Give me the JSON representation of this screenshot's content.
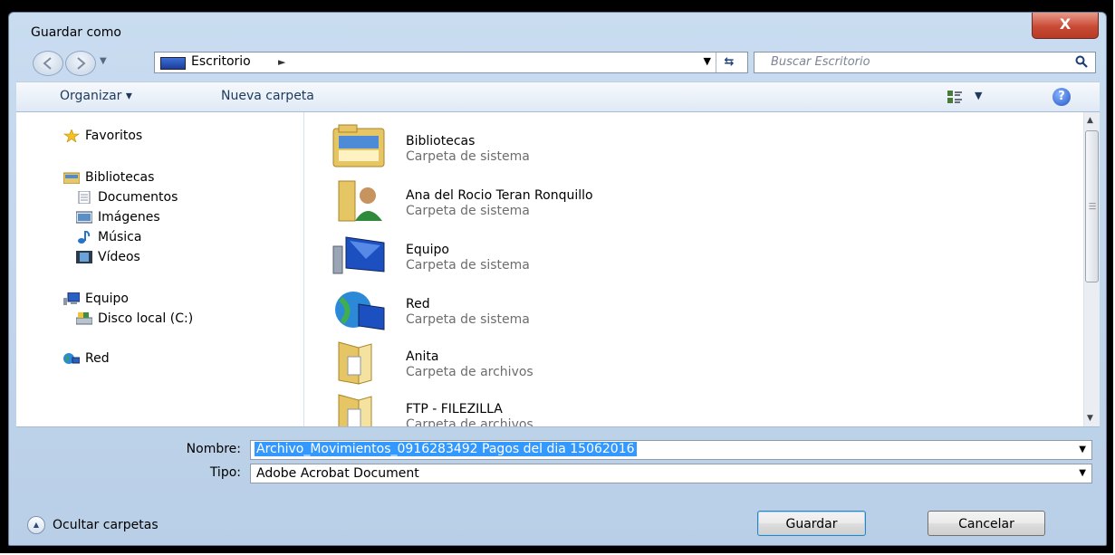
{
  "window": {
    "title": "Guardar como",
    "close_label": "X"
  },
  "navbar": {
    "address_label": "Escritorio",
    "search_placeholder": "Buscar Escritorio"
  },
  "toolbar": {
    "organize_label": "Organizar ▾",
    "new_folder_label": "Nueva carpeta"
  },
  "sidebar": {
    "favorites": "Favoritos",
    "libraries": "Bibliotecas",
    "documents": "Documentos",
    "images": "Imágenes",
    "music": "Música",
    "videos": "Vídeos",
    "computer": "Equipo",
    "local_disk": "Disco local (C:)",
    "network": "Red"
  },
  "files": [
    {
      "name": "Bibliotecas",
      "type": "Carpeta de sistema",
      "icon": "libraries-folder-icon"
    },
    {
      "name": "Ana del Rocio Teran Ronquillo",
      "type": "Carpeta de sistema",
      "icon": "user-folder-icon"
    },
    {
      "name": "Equipo",
      "type": "Carpeta de sistema",
      "icon": "computer-icon"
    },
    {
      "name": "Red",
      "type": "Carpeta de sistema",
      "icon": "network-icon"
    },
    {
      "name": "Anita",
      "type": "Carpeta de archivos",
      "icon": "folder-icon"
    },
    {
      "name": "FTP - FILEZILLA",
      "type": "Carpeta de archivos",
      "icon": "folder-icon"
    }
  ],
  "form": {
    "name_label": "Nombre:",
    "name_value": "Archivo_Movimientos_0916283492 Pagos del dia 15062016",
    "type_label": "Tipo:",
    "type_value": "Adobe Acrobat Document"
  },
  "footer": {
    "hide_folders_label": "Ocultar carpetas",
    "save_label": "Guardar",
    "cancel_label": "Cancelar"
  },
  "colors": {
    "selection": "#3399ff",
    "title_bar": "#c9dcf0",
    "close_button": "#c94b36"
  }
}
